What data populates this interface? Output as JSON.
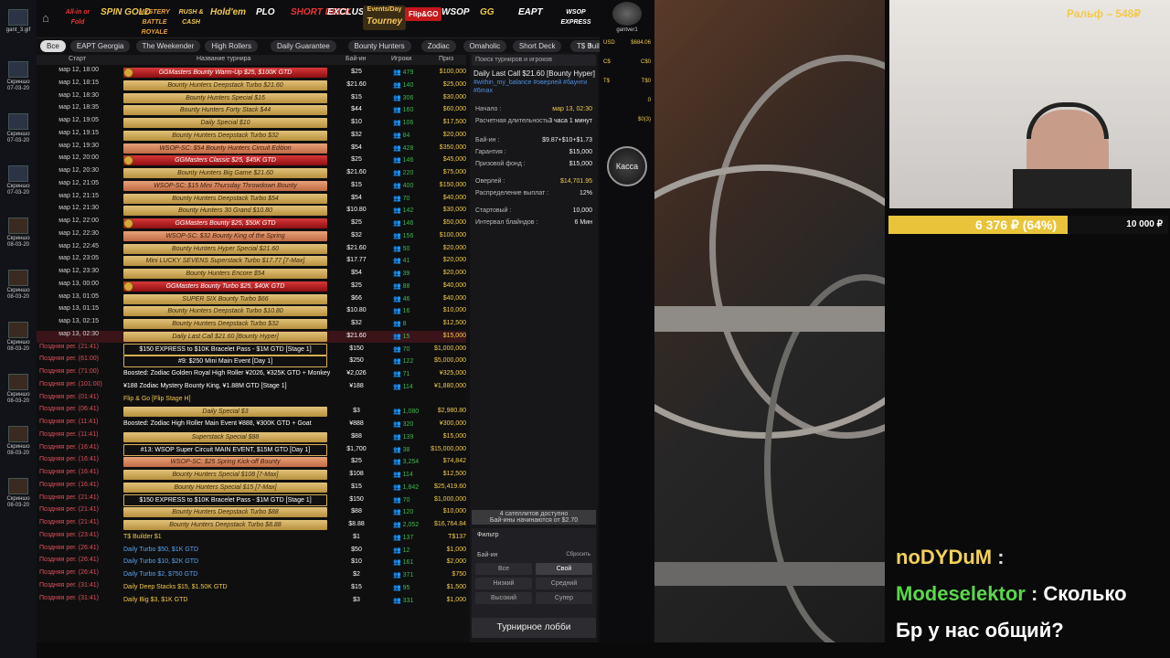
{
  "desktop": [
    {
      "label": "gant_3.gif"
    },
    {
      "label": "Скриншо\n07-03-20"
    },
    {
      "label": "Скриншо\n07-03-20"
    },
    {
      "label": "Скриншо\n07-03-20"
    },
    {
      "label": "Скриншо\n08-03-20"
    },
    {
      "label": "Скриншо\n08-03-20"
    },
    {
      "label": "Скриншо\n08-03-20"
    },
    {
      "label": "Скриншо\n08-03-20"
    },
    {
      "label": "Скриншо\n08-03-20"
    },
    {
      "label": "Скриншо\n08-03-20"
    }
  ],
  "games": [
    {
      "l": "All-in or Fold",
      "c": "#e33"
    },
    {
      "l": "SPIN GOLD",
      "c": "#f2c94c"
    },
    {
      "l": "MYSTERY BATTLE ROYALE",
      "c": "#e8a23a"
    },
    {
      "l": "RUSH & CASH",
      "c": "#f2c94c"
    },
    {
      "l": "Hold'em",
      "c": "#f2c94c"
    },
    {
      "l": "PLO",
      "c": "#fff"
    },
    {
      "l": "SHORT DECK",
      "c": "#e33"
    },
    {
      "l": "EXCLUSIVE",
      "c": "#fff"
    },
    {
      "l": "Tourney",
      "sub": "Events/Day",
      "active": true
    },
    {
      "l": "Flip&GO",
      "c": "#fff",
      "badge": true
    },
    {
      "l": "WSOP",
      "c": "#fff"
    },
    {
      "l": "GG",
      "c": "#f2c94c"
    },
    {
      "l": "EAPT",
      "c": "#fff"
    },
    {
      "l": "WSOP EXPRESS",
      "c": "#fff"
    }
  ],
  "filters": [
    "Все",
    "EAPT Georgia",
    "The Weekender",
    "High Rollers",
    "Daily Guarantee",
    "Bounty Hunters",
    "Zodiac",
    "Omaholic",
    "Short Deck",
    "T$ Builder",
    "Freeroll"
  ],
  "cols": {
    "start": "Старт",
    "name": "Название турнира",
    "buyin": "Бай-ин",
    "players": "Игроки",
    "prize": "Приз"
  },
  "rows": [
    {
      "t": "мар 12, 18:00",
      "n": "GGMasters Bounty Warm-Up $25, $100K GTD",
      "b": "$25",
      "p": "479",
      "z": "$100,000",
      "s": "red"
    },
    {
      "t": "мар 12, 18:15",
      "n": "Bounty Hunters Deepstack Turbo $21.60",
      "b": "$21.60",
      "p": "140",
      "z": "$25,000",
      "s": "gold"
    },
    {
      "t": "мар 12, 18:30",
      "n": "Bounty Hunters Special $15",
      "b": "$15",
      "p": "306",
      "z": "$30,000",
      "s": "gold"
    },
    {
      "t": "мар 12, 18:35",
      "n": "Bounty Hunters Forty Stack $44",
      "b": "$44",
      "p": "160",
      "z": "$60,000",
      "s": "gold"
    },
    {
      "t": "мар 12, 19:05",
      "n": "Daily Special $10",
      "b": "$10",
      "p": "106",
      "z": "$17,500",
      "s": "gold"
    },
    {
      "t": "мар 12, 19:15",
      "n": "Bounty Hunters Deepstack Turbo $32",
      "b": "$32",
      "p": "84",
      "z": "$20,000",
      "s": "gold"
    },
    {
      "t": "мар 12, 19:30",
      "n": "WSOP-SC: $54 Bounty Hunters Circuit Edition",
      "b": "$54",
      "p": "428",
      "z": "$350,000",
      "s": "coral"
    },
    {
      "t": "мар 12, 20:00",
      "n": "GGMasters Classic $25, $45K GTD",
      "b": "$25",
      "p": "146",
      "z": "$45,000",
      "s": "red"
    },
    {
      "t": "мар 12, 20:30",
      "n": "Bounty Hunters Big Game $21.60",
      "b": "$21.60",
      "p": "220",
      "z": "$75,000",
      "s": "gold"
    },
    {
      "t": "мар 12, 21:05",
      "n": "WSOP-SC: $15 Mini Thursday Throwdown Bounty",
      "b": "$15",
      "p": "400",
      "z": "$150,000",
      "s": "coral"
    },
    {
      "t": "мар 12, 21:15",
      "n": "Bounty Hunters Deepstack Turbo $54",
      "b": "$54",
      "p": "70",
      "z": "$40,000",
      "s": "gold"
    },
    {
      "t": "мар 12, 21:30",
      "n": "Bounty Hunters 30 Grand $10.80",
      "b": "$10.80",
      "p": "142",
      "z": "$30,000",
      "s": "gold"
    },
    {
      "t": "мар 12, 22:00",
      "n": "GGMasters Bounty $25, $50K GTD",
      "b": "$25",
      "p": "146",
      "z": "$50,000",
      "s": "red"
    },
    {
      "t": "мар 12, 22:30",
      "n": "WSOP-SC: $32 Bounty King of the Spring",
      "b": "$32",
      "p": "156",
      "z": "$100,000",
      "s": "coral"
    },
    {
      "t": "мар 12, 22:45",
      "n": "Bounty Hunters Hyper Special $21.60",
      "b": "$21.60",
      "p": "50",
      "z": "$20,000",
      "s": "gold"
    },
    {
      "t": "мар 12, 23:05",
      "n": "Mini LUCKY SEVENS Superstack Turbo $17.77 [7-Max]",
      "b": "$17.77",
      "p": "41",
      "z": "$20,000",
      "s": "gold"
    },
    {
      "t": "мар 12, 23:30",
      "n": "Bounty Hunters Encore $54",
      "b": "$54",
      "p": "39",
      "z": "$20,000",
      "s": "gold"
    },
    {
      "t": "мар 13, 00:00",
      "n": "GGMasters Bounty Turbo $25, $40K GTD",
      "b": "$25",
      "p": "88",
      "z": "$40,000",
      "s": "red"
    },
    {
      "t": "мар 13, 01:05",
      "n": "SUPER SIX Bounty Turbo $66",
      "b": "$66",
      "p": "46",
      "z": "$40,000",
      "s": "gold"
    },
    {
      "t": "мар 13, 01:15",
      "n": "Bounty Hunters Deepstack Turbo $10.80",
      "b": "$10.80",
      "p": "16",
      "z": "$10,000",
      "s": "gold"
    },
    {
      "t": "мар 13, 02:15",
      "n": "Bounty Hunters Deepstack Turbo $32",
      "b": "$32",
      "p": "8",
      "z": "$12,500",
      "s": "gold"
    },
    {
      "t": "мар 13, 02:30",
      "n": "Daily Last Call $21.60 [Bounty Hyper]",
      "b": "$21.60",
      "p": "15",
      "z": "$15,000",
      "s": "gold",
      "sel": true
    },
    {
      "t": "Поздняя рег. (21:41)",
      "n": "$150 EXPRESS to $10K Bracelet Pass - $1M GTD [Stage 1]",
      "b": "$150",
      "p": "70",
      "z": "$1,000,000",
      "s": "big",
      "late": true
    },
    {
      "t": "Поздняя рег. (61:00)",
      "n": "#9: $250 Mini Main Event [Day 1]",
      "b": "$250",
      "p": "122",
      "z": "$5,000,000",
      "s": "big",
      "late": true
    },
    {
      "t": "Поздняя рег. (71:00)",
      "n": "Boosted: Zodiac Golden Royal High Roller ¥2026, ¥325K GTD + Monkey",
      "b": "¥2,026",
      "p": "71",
      "z": "¥325,000",
      "s": "text",
      "late": true
    },
    {
      "t": "Поздняя рег. (101:00)",
      "n": "¥188 Zodiac Mystery Bounty King, ¥1.88M GTD [Stage 1]",
      "b": "¥188",
      "p": "114",
      "z": "¥1,880,000",
      "s": "text",
      "late": true
    },
    {
      "t": "Поздняя рег. (01:41)",
      "n": "Flip & Go  [Flip Stage H]",
      "b": "",
      "p": "",
      "z": "",
      "s": "texty",
      "late": true
    },
    {
      "t": "Поздняя рег. (06:41)",
      "n": "Daily Special $3",
      "b": "$3",
      "p": "1,080",
      "z": "$2,980.80",
      "s": "gold",
      "late": true
    },
    {
      "t": "Поздняя рег. (11:41)",
      "n": "Boosted: Zodiac High Roller Main Event ¥888, ¥300K GTD + Goat",
      "b": "¥888",
      "p": "320",
      "z": "¥300,000",
      "s": "text",
      "late": true
    },
    {
      "t": "Поздняя рег. (11:41)",
      "n": "Superstack Special $88",
      "b": "$88",
      "p": "139",
      "z": "$15,000",
      "s": "gold",
      "late": true
    },
    {
      "t": "Поздняя рег. (16:41)",
      "n": "#13: WSOP Super Circuit MAIN EVENT, $15M GTD [Day 1]",
      "b": "$1,700",
      "p": "38",
      "z": "$15,000,000",
      "s": "big",
      "late": true
    },
    {
      "t": "Поздняя рег. (16:41)",
      "n": "WSOP-SC: $25 Spring Kick-off Bounty",
      "b": "$25",
      "p": "3,254",
      "z": "$74,842",
      "s": "coral",
      "late": true
    },
    {
      "t": "Поздняя рег. (16:41)",
      "n": "Bounty Hunters Special $108 [7-Max]",
      "b": "$108",
      "p": "114",
      "z": "$12,500",
      "s": "gold",
      "late": true
    },
    {
      "t": "Поздняя рег. (16:41)",
      "n": "Bounty Hunters Special $15 [7-Max]",
      "b": "$15",
      "p": "1,842",
      "z": "$25,419.60",
      "s": "gold",
      "late": true
    },
    {
      "t": "Поздняя рег. (21:41)",
      "n": "$150 EXPRESS to $10K Bracelet Pass - $1M GTD [Stage 1]",
      "b": "$150",
      "p": "70",
      "z": "$1,000,000",
      "s": "big",
      "late": true
    },
    {
      "t": "Поздняя рег. (21:41)",
      "n": "Bounty Hunters Deepstack Turbo $88",
      "b": "$88",
      "p": "120",
      "z": "$10,000",
      "s": "gold",
      "late": true
    },
    {
      "t": "Поздняя рег. (21:41)",
      "n": "Bounty Hunters Deepstack Turbo $8.88",
      "b": "$8.88",
      "p": "2,052",
      "z": "$16,764.84",
      "s": "gold",
      "late": true
    },
    {
      "t": "Поздняя рег. (23:41)",
      "n": "T$ Builder $1",
      "b": "$1",
      "p": "137",
      "z": "T$137",
      "s": "texty",
      "late": true
    },
    {
      "t": "Поздняя рег. (26:41)",
      "n": "Daily Turbo $50, $1K GTD",
      "b": "$50",
      "p": "12",
      "z": "$1,000",
      "s": "textb",
      "late": true
    },
    {
      "t": "Поздняя рег. (26:41)",
      "n": "Daily Turbo $10, $2K GTD",
      "b": "$10",
      "p": "161",
      "z": "$2,000",
      "s": "textb",
      "late": true
    },
    {
      "t": "Поздняя рег. (26:41)",
      "n": "Daily Turbo $2, $750 GTD",
      "b": "$2",
      "p": "371",
      "z": "$750",
      "s": "textb",
      "late": true
    },
    {
      "t": "Поздняя рег. (31:41)",
      "n": "Daily Deep Stacks $15, $1.50K GTD",
      "b": "$15",
      "p": "95",
      "z": "$1,500",
      "s": "texty",
      "late": true
    },
    {
      "t": "Поздняя рег. (31:41)",
      "n": "Daily Big $3, $1K GTD",
      "b": "$3",
      "p": "331",
      "z": "$1,000",
      "s": "texty",
      "late": true
    }
  ],
  "detail": {
    "search": "Поиск турниров и игроков",
    "title": "Daily Last Call $21.60 [Bounty Hyper]",
    "tags": "#within_my_balance #оверлей #баунти #6max",
    "kv": [
      [
        "Начало :",
        "мар 13, 02:30",
        true
      ],
      [
        "Расчетная длительность :",
        "3 часа 1 минут",
        false
      ],
      [
        "Бай-ин :",
        "$9.87+$10+$1.73",
        false
      ],
      [
        "Гарантия :",
        "$15,000",
        false
      ],
      [
        "Призовой фонд :",
        "$15,000",
        false
      ],
      [
        "Оверлей :",
        "$14,701.95",
        true
      ],
      [
        "Распределение выплат :",
        "12%",
        false
      ],
      [
        "Стартовый :",
        "10,000",
        false
      ],
      [
        "Интервал блайндов :",
        "6 Мин",
        false
      ]
    ],
    "sat": "4 сателлитов доступно\nБай-ины начинаются от $2.70",
    "filter": "Фильтр",
    "buyin": "Бай-ин",
    "reset": "Сбросить",
    "opts": [
      "Все",
      "Свой",
      "Низкий",
      "Средний",
      "Высокий",
      "Супер"
    ],
    "lobby": "Турнирное лобби"
  },
  "side": {
    "user": "gantver1",
    "bal": [
      [
        "USD",
        "$684.06"
      ],
      [
        "C$",
        "C$0"
      ],
      [
        "T$",
        "T$0"
      ],
      [
        "",
        "0"
      ],
      [
        "",
        "$0(3)"
      ]
    ],
    "cashier": "Касса"
  },
  "cam": {
    "name": "Ральф – 548₽",
    "progress": "6 376 ₽ (64%)",
    "goal": "10 000 ₽",
    "fill": 0.64
  },
  "chat": [
    {
      "user": "noDYDuM",
      "msg": "",
      "uc": "#f2d05a"
    },
    {
      "user": "Modeselektor",
      "msg": "Сколько",
      "uc": "#5ad84a"
    },
    {
      "user": "",
      "msg": "Бр у нас общий?",
      "uc": "#fff"
    }
  ],
  "colors": {
    "gold": "#d6b056",
    "red": "#b3191c",
    "coral": "#d88a5e",
    "late": "#e0505a",
    "green": "#3fb84c"
  }
}
